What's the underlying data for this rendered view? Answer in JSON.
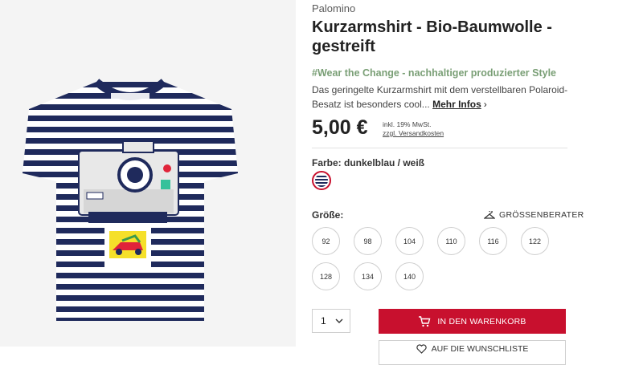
{
  "product": {
    "brand": "Palomino",
    "title": "Kurzarmshirt - Bio-Baumwolle - gestreift",
    "tagline": "#Wear the Change - nachhaltiger produzierter Style",
    "description": "Das geringelte Kurzarmshirt mit dem verstellbaren Polaroid-Besatz ist besonders cool...",
    "more_link": "Mehr Infos",
    "price": "5,00 €",
    "vat_note": "inkl. 19% MwSt.",
    "shipping_note": "zzgl. Versandkosten"
  },
  "color": {
    "label": "Farbe: dunkelblau / weiß",
    "selected_swatch": "navy-white-stripes"
  },
  "size": {
    "label": "Größe:",
    "advisor": "GRÖSSENBERATER",
    "options": [
      "92",
      "98",
      "104",
      "110",
      "116",
      "122",
      "128",
      "134",
      "140"
    ]
  },
  "cart": {
    "quantity": "1",
    "add_to_cart": "IN DEN WARENKORB",
    "wishlist": "AUF DIE WUNSCHLISTE"
  },
  "icons": [
    "chevron-right-icon",
    "hanger-icon",
    "chevron-down-icon",
    "cart-icon",
    "heart-icon"
  ],
  "colors": {
    "accent": "#c8102e",
    "tagline": "#7a9f76",
    "image_bg": "#f4f4f4",
    "navy": "#1f2a5c"
  }
}
